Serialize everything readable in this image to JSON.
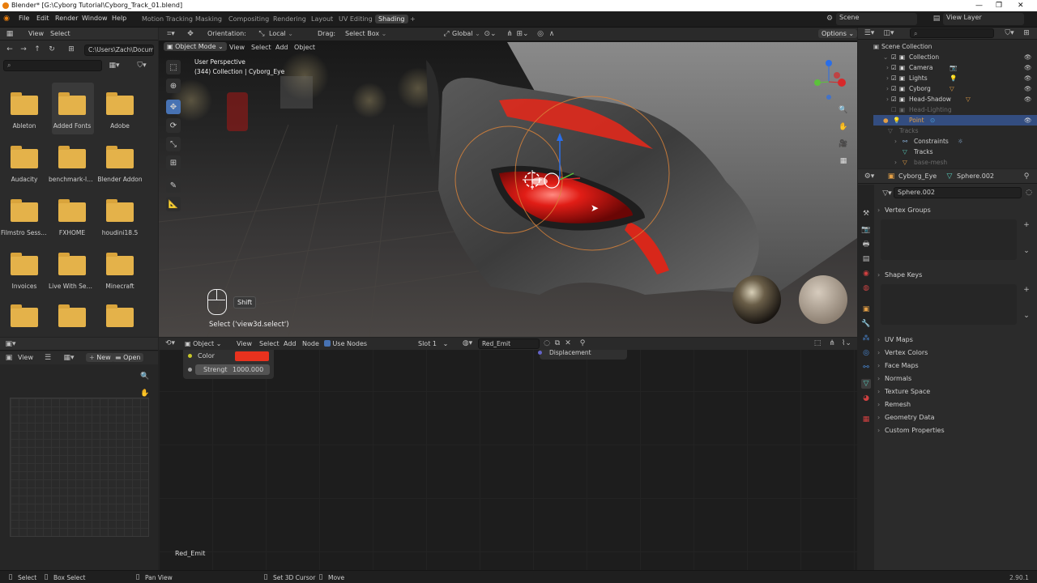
{
  "window": {
    "title": "Blender* [G:\\Cyborg Tutorial\\Cyborg_Track_01.blend]",
    "min": "—",
    "max": "❐",
    "close": "✕"
  },
  "menu": [
    "File",
    "Edit",
    "Render",
    "Window",
    "Help"
  ],
  "workspaces": [
    "Motion Tracking",
    "Masking",
    "Compositing",
    "Rendering",
    "Layout",
    "UV Editing",
    "Shading",
    "+"
  ],
  "scene": {
    "label": "Scene",
    "view_layer": "View Layer"
  },
  "file_browser": {
    "view": "View",
    "select": "Select",
    "path": "C:\\Users\\Zach\\Docum...",
    "folders": [
      "Ableton",
      "Added Fonts",
      "Adobe",
      "Audacity",
      "benchmark-la...",
      "Blender Addon",
      "Filmstro Sessi...",
      "FXHOME",
      "houdini18.5",
      "Invoices",
      "Live With Sen...",
      "Minecraft",
      "",
      "",
      ""
    ]
  },
  "viewport": {
    "orientation_label": "Orientation:",
    "orientation": "Local",
    "drag_label": "Drag:",
    "drag": "Select Box",
    "transform": "Global",
    "options": "Options",
    "mode": "Object Mode",
    "menu": [
      "View",
      "Select",
      "Add",
      "Object"
    ],
    "perspective": "User Perspective",
    "collection": "(344) Collection | Cyborg_Eye",
    "key_hint": "Shift",
    "operator": "Select ('view3d.select')"
  },
  "image_editor": {
    "view": "View",
    "new": "New",
    "open": "Open"
  },
  "node_editor": {
    "type": "Object",
    "menu": [
      "View",
      "Select",
      "Add",
      "Node"
    ],
    "use_nodes": "Use Nodes",
    "slot": "Slot 1",
    "material": "Red_Emit",
    "color_label": "Color",
    "color_value": "#e8321e",
    "strength_label": "Strengt",
    "strength_value": "1000.000",
    "displacement": "Displacement",
    "material_name": "Red_Emit"
  },
  "outliner": {
    "rows": [
      {
        "label": "Scene Collection",
        "indent": 0
      },
      {
        "label": "Collection",
        "indent": 1
      },
      {
        "label": "Camera",
        "indent": 2
      },
      {
        "label": "Lights",
        "indent": 2
      },
      {
        "label": "Cyborg",
        "indent": 2
      },
      {
        "label": "Head-Shadow",
        "indent": 2
      },
      {
        "label": "Head-Lighting",
        "indent": 2
      },
      {
        "label": "Point",
        "indent": 2
      },
      {
        "label": "Tracks",
        "indent": 2
      },
      {
        "label": "Constraints",
        "indent": 3
      },
      {
        "label": "Tracks",
        "indent": 3
      },
      {
        "label": "base-mesh",
        "indent": 3
      }
    ]
  },
  "properties": {
    "object": "Cyborg_Eye",
    "mesh": "Sphere.002",
    "data_name": "Sphere.002",
    "vertex_groups": "Vertex Groups",
    "shape_keys": "Shape Keys",
    "categories": [
      "UV Maps",
      "Vertex Colors",
      "Face Maps",
      "Normals",
      "Texture Space",
      "Remesh",
      "Geometry Data",
      "Custom Properties"
    ]
  },
  "status": {
    "select": "Select",
    "box_select": "Box Select",
    "pan": "Pan View",
    "cursor": "Set 3D Cursor",
    "move": "Move",
    "version": "2.90.1"
  }
}
